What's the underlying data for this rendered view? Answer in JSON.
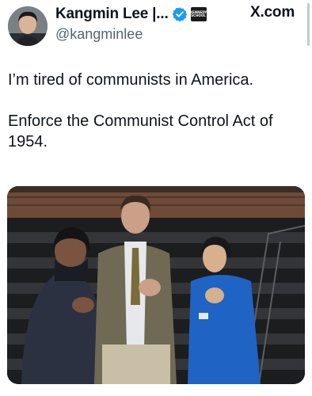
{
  "author": {
    "display_name": "Kangmin Lee |...",
    "handle": "@kangminlee",
    "verified_icon": "verified-badge-icon",
    "affiliation_badge_text": "KENNEDY\nSCHOOL"
  },
  "site_label": "X.com",
  "tweet": {
    "paragraphs": [
      "I’m tired of communists in America.",
      "Enforce the Communist Control Act of 1954."
    ]
  },
  "media": {
    "description_icon": "photo-icon"
  },
  "colors": {
    "text": "#0f1419",
    "secondary_text": "#536471",
    "verified_blue": "#1d9bf0"
  }
}
